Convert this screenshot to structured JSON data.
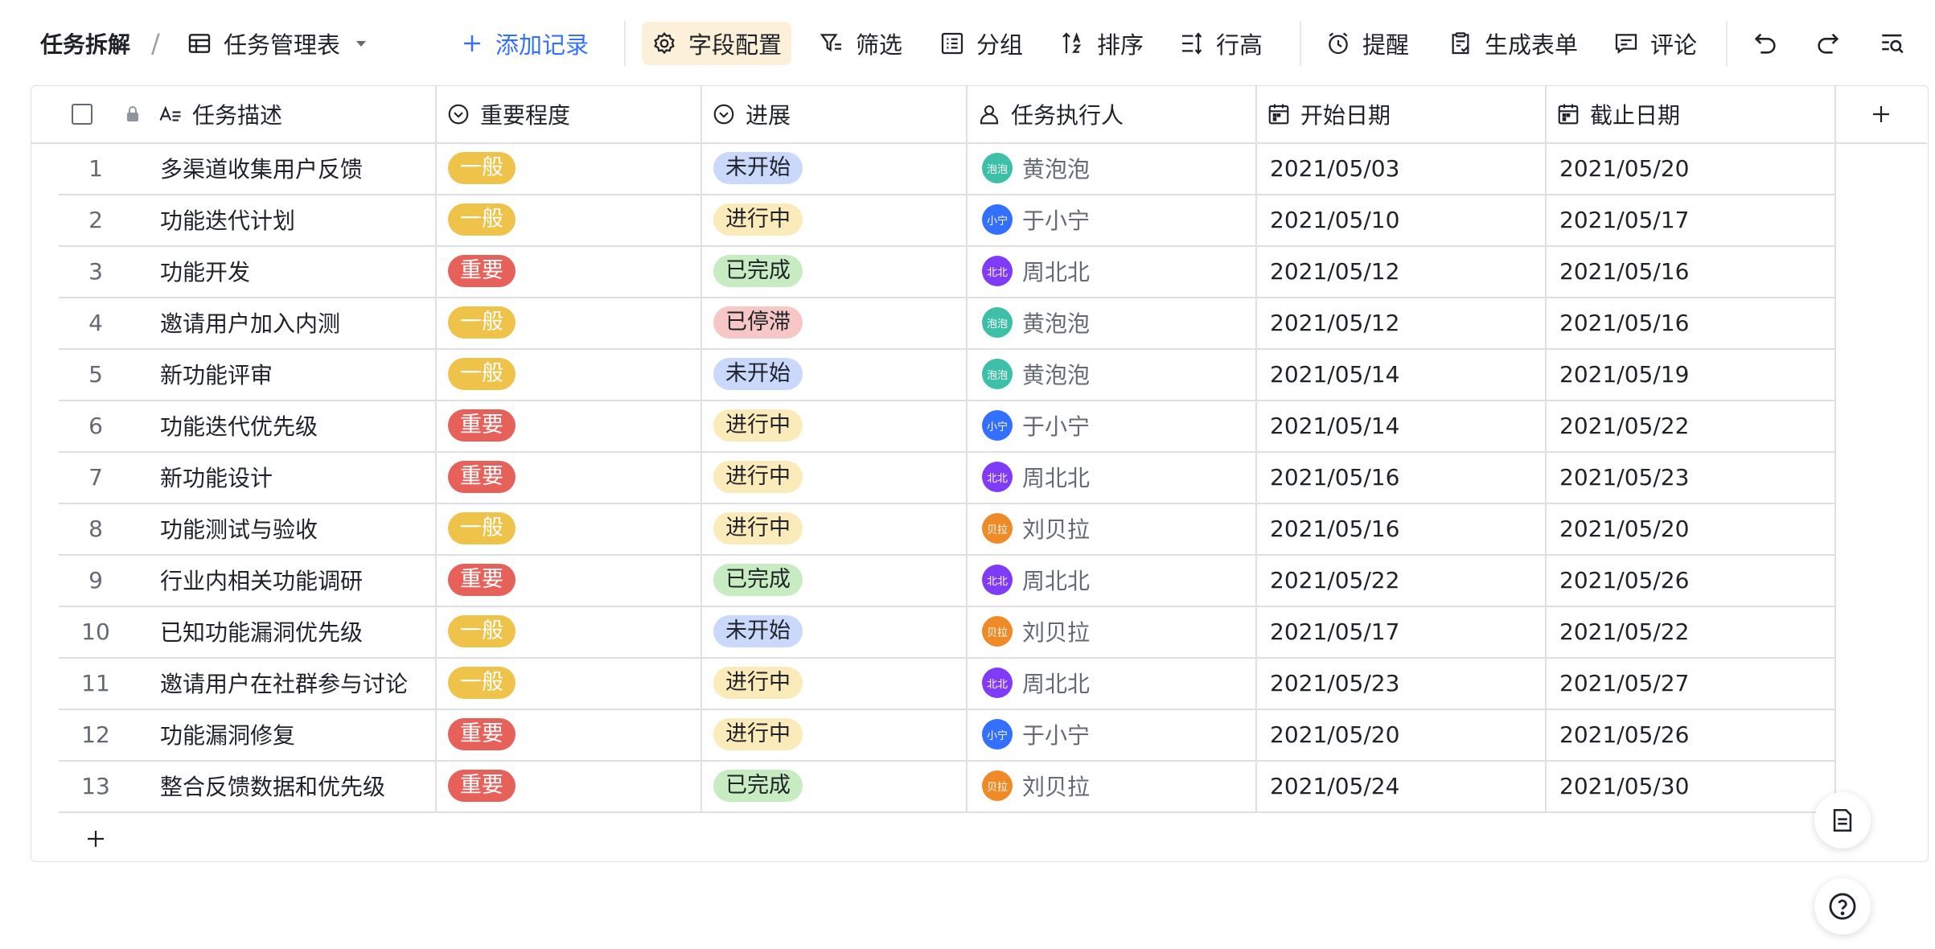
{
  "toolbar": {
    "base_title": "任务拆解",
    "separator": "/",
    "view_name": "任务管理表",
    "add_record": "添加记录",
    "field_config": "字段配置",
    "filter": "筛选",
    "group": "分组",
    "sort": "排序",
    "row_height": "行高",
    "reminder": "提醒",
    "generate_form": "生成表单",
    "comment": "评论"
  },
  "columns": [
    "任务描述",
    "重要程度",
    "进展",
    "任务执行人",
    "开始日期",
    "截止日期"
  ],
  "colors": {
    "accent": "#3370ff",
    "tag_normal": "#efc24a",
    "tag_important": "#e5615a"
  },
  "people": {
    "黄泡泡": {
      "initials": "泡泡",
      "color": "#3dbfa8"
    },
    "于小宁": {
      "initials": "小宁",
      "color": "#3370ff"
    },
    "周北北": {
      "initials": "北北",
      "color": "#7f3bf5"
    },
    "刘贝拉": {
      "initials": "贝拉",
      "color": "#ef8a28"
    }
  },
  "rows": [
    {
      "num": "1",
      "task": "多渠道收集用户反馈",
      "priority": "一般",
      "priority_kind": "normal",
      "status": "未开始",
      "status_kind": "notstart",
      "owner": "黄泡泡",
      "start": "2021/05/03",
      "end": "2021/05/20"
    },
    {
      "num": "2",
      "task": "功能迭代计划",
      "priority": "一般",
      "priority_kind": "normal",
      "status": "进行中",
      "status_kind": "doing",
      "owner": "于小宁",
      "start": "2021/05/10",
      "end": "2021/05/17"
    },
    {
      "num": "3",
      "task": "功能开发",
      "priority": "重要",
      "priority_kind": "important",
      "status": "已完成",
      "status_kind": "done",
      "owner": "周北北",
      "start": "2021/05/12",
      "end": "2021/05/16"
    },
    {
      "num": "4",
      "task": "邀请用户加入内测",
      "priority": "一般",
      "priority_kind": "normal",
      "status": "已停滞",
      "status_kind": "stalled",
      "owner": "黄泡泡",
      "start": "2021/05/12",
      "end": "2021/05/16"
    },
    {
      "num": "5",
      "task": "新功能评审",
      "priority": "一般",
      "priority_kind": "normal",
      "status": "未开始",
      "status_kind": "notstart",
      "owner": "黄泡泡",
      "start": "2021/05/14",
      "end": "2021/05/19"
    },
    {
      "num": "6",
      "task": "功能迭代优先级",
      "priority": "重要",
      "priority_kind": "important",
      "status": "进行中",
      "status_kind": "doing",
      "owner": "于小宁",
      "start": "2021/05/14",
      "end": "2021/05/22"
    },
    {
      "num": "7",
      "task": "新功能设计",
      "priority": "重要",
      "priority_kind": "important",
      "status": "进行中",
      "status_kind": "doing",
      "owner": "周北北",
      "start": "2021/05/16",
      "end": "2021/05/23"
    },
    {
      "num": "8",
      "task": "功能测试与验收",
      "priority": "一般",
      "priority_kind": "normal",
      "status": "进行中",
      "status_kind": "doing",
      "owner": "刘贝拉",
      "start": "2021/05/16",
      "end": "2021/05/20"
    },
    {
      "num": "9",
      "task": "行业内相关功能调研",
      "priority": "重要",
      "priority_kind": "important",
      "status": "已完成",
      "status_kind": "done",
      "owner": "周北北",
      "start": "2021/05/22",
      "end": "2021/05/26"
    },
    {
      "num": "10",
      "task": "已知功能漏洞优先级",
      "priority": "一般",
      "priority_kind": "normal",
      "status": "未开始",
      "status_kind": "notstart",
      "owner": "刘贝拉",
      "start": "2021/05/17",
      "end": "2021/05/22"
    },
    {
      "num": "11",
      "task": "邀请用户在社群参与讨论",
      "priority": "一般",
      "priority_kind": "normal",
      "status": "进行中",
      "status_kind": "doing",
      "owner": "周北北",
      "start": "2021/05/23",
      "end": "2021/05/27"
    },
    {
      "num": "12",
      "task": "功能漏洞修复",
      "priority": "重要",
      "priority_kind": "important",
      "status": "进行中",
      "status_kind": "doing",
      "owner": "于小宁",
      "start": "2021/05/20",
      "end": "2021/05/26"
    },
    {
      "num": "13",
      "task": "整合反馈数据和优先级",
      "priority": "重要",
      "priority_kind": "important",
      "status": "已完成",
      "status_kind": "done",
      "owner": "刘贝拉",
      "start": "2021/05/24",
      "end": "2021/05/30"
    }
  ]
}
